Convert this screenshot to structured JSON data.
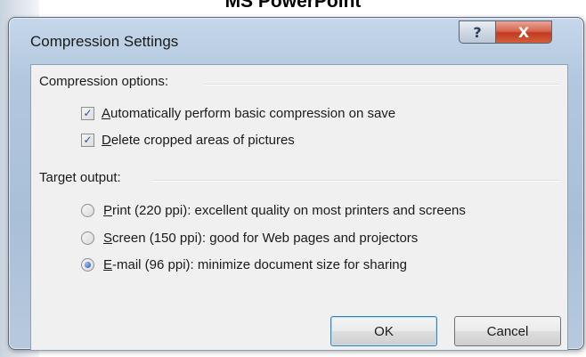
{
  "caption": "MS PowerPoint",
  "dialog": {
    "title": "Compression Settings",
    "help_symbol": "?",
    "close_symbol": "X"
  },
  "compression_options": {
    "label": "Compression options:",
    "items": [
      {
        "underline": "A",
        "text": "utomatically perform basic compression on save",
        "checked": true
      },
      {
        "underline": "D",
        "text": "elete cropped areas of pictures",
        "checked": true
      }
    ]
  },
  "target_output": {
    "label": "Target output:",
    "items": [
      {
        "underline": "P",
        "text": "rint (220 ppi): excellent quality on most printers and screens",
        "selected": false
      },
      {
        "underline": "S",
        "text": "creen (150 ppi): good for Web pages and projectors",
        "selected": false
      },
      {
        "underline": "E",
        "text": "-mail (96 ppi): minimize document size for sharing",
        "selected": true
      }
    ]
  },
  "buttons": {
    "ok": "OK",
    "cancel": "Cancel"
  },
  "check_symbol": "✓"
}
